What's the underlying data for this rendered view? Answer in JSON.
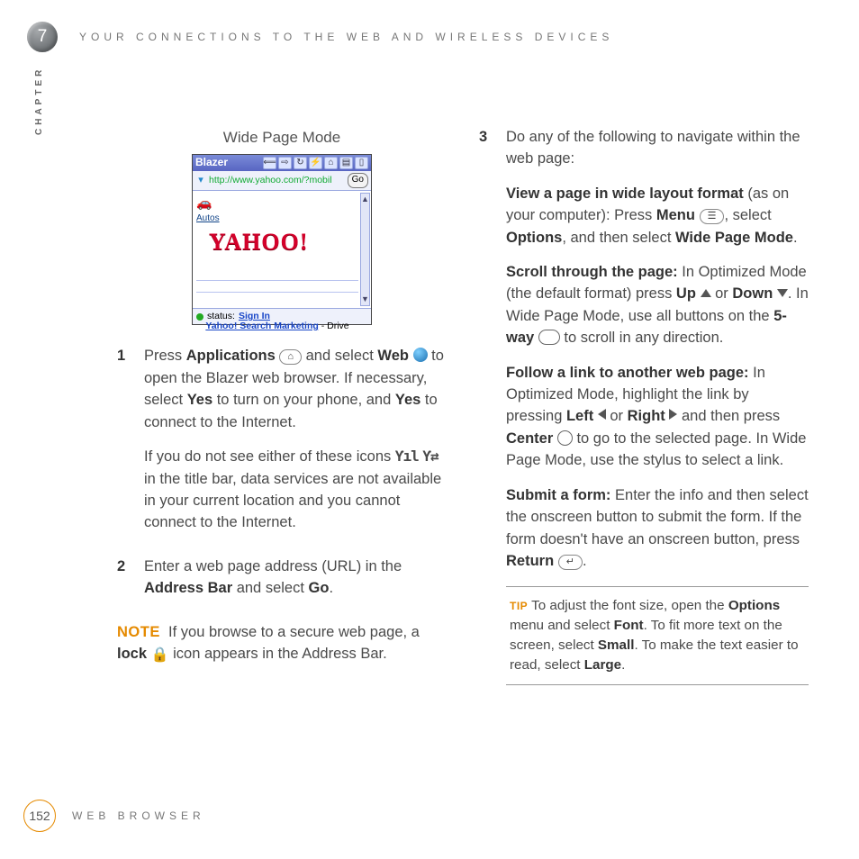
{
  "chapter": {
    "number": "7",
    "label": "CHAPTER",
    "header": "YOUR CONNECTIONS TO THE WEB AND WIRELESS DEVICES"
  },
  "caption": "Wide Page Mode",
  "figure": {
    "app": "Blazer",
    "url": "http://www.yahoo.com/?mobil",
    "go": "Go",
    "autos": "Autos",
    "logo": "YAHOO!",
    "marketing_link": "Yahoo! Search Marketing",
    "marketing_tail": " - Drive",
    "status_label": "status:",
    "status_link": "Sign In"
  },
  "left": {
    "step1": {
      "n": "1",
      "a1": "Press ",
      "a2": "Applications",
      "a3": " and select ",
      "b1": "Web",
      "b2": " to open the Blazer web browser. If necessary, select ",
      "b3": "Yes",
      "b4": " to turn on your phone, and ",
      "b5": "Yes",
      "b6": " to connect to the Internet.",
      "c1": "If you do not see either of these icons ",
      "c2": " in the title bar, data services are not available in your current location and you cannot connect to the Internet."
    },
    "step2": {
      "n": "2",
      "a1": "Enter a web page address (URL) in the ",
      "a2": "Address Bar",
      "a3": " and select ",
      "a4": "Go",
      "a5": "."
    },
    "note": {
      "label": "NOTE",
      "a1": "If you browse to a secure web page, a ",
      "a2": "lock",
      "a3": " icon appears in the Address Bar."
    }
  },
  "right": {
    "step3": {
      "n": "3",
      "intro": "Do any of the following to navigate within the web page:",
      "p1": {
        "a": "View a page in wide layout format",
        "b": " (as on your computer): Press ",
        "c": "Menu",
        "d": ", select ",
        "e": "Options",
        "f": ", and then select ",
        "g": "Wide Page Mode",
        "h": "."
      },
      "p2": {
        "a": "Scroll through the page:",
        "b": " In Optimized Mode (the default format) press ",
        "c": "Up",
        "d": " or ",
        "e": "Down",
        "f": ". In Wide Page Mode, use all buttons on the ",
        "g": "5-way",
        "h": " to scroll in any direction."
      },
      "p3": {
        "a": "Follow a link to another web page:",
        "b": " In Optimized Mode, highlight the link by pressing ",
        "c": "Left",
        "d": " or ",
        "e": "Right",
        "f": " and then press ",
        "g": "Center",
        "h": " to go to the selected page. In Wide Page Mode, use the stylus to select a link."
      },
      "p4": {
        "a": "Submit a form:",
        "b": " Enter the info and then select the onscreen button to submit the form. If the form doesn't have an onscreen button, press ",
        "c": "Return",
        "d": "."
      }
    },
    "tip": {
      "label": "TIP",
      "a": "To adjust the font size, open the ",
      "b": "Options",
      "c": " menu and select ",
      "d": "Font",
      "e": ". To fit more text on the screen, select ",
      "f": "Small",
      "g": ". To make the text easier to read, select ",
      "h": "Large",
      "i": "."
    }
  },
  "footer": {
    "page": "152",
    "section": "WEB BROWSER"
  }
}
